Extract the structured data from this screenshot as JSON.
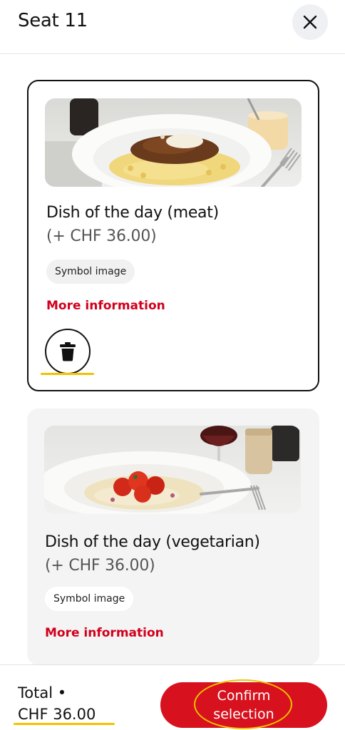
{
  "header": {
    "title": "Seat 11",
    "close_icon": "close-icon"
  },
  "dishes": [
    {
      "name": "Dish of the day (meat)",
      "price": "(+ CHF 36.00)",
      "tag": "Symbol image",
      "more_info": "More information",
      "selected": true,
      "image_icon": "pasta-dish-image",
      "delete_icon": "trash-icon"
    },
    {
      "name": "Dish of the day (vegetarian)",
      "price": "(+ CHF 36.00)",
      "tag": "Symbol image",
      "more_info": "More information",
      "selected": false,
      "image_icon": "risotto-dish-image"
    }
  ],
  "footer": {
    "total_label": "Total •",
    "total_amount": "CHF 36.00",
    "confirm_label": "Confirm selection"
  },
  "colors": {
    "accent_red": "#d7111e",
    "link_red": "#d1001c",
    "highlight_yellow": "#f2c200"
  }
}
